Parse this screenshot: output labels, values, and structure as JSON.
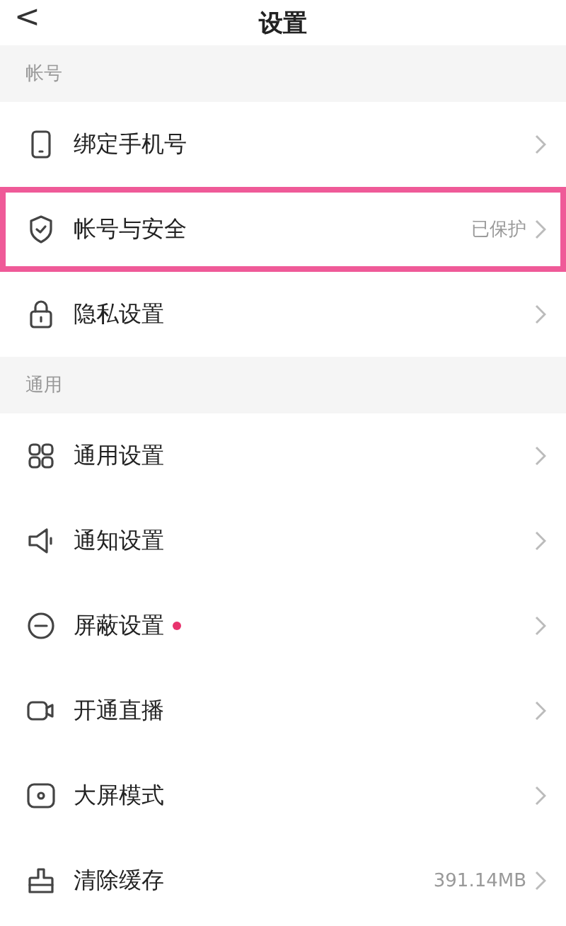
{
  "header": {
    "back": "<",
    "title": "设置"
  },
  "sections": [
    {
      "title": "帐号",
      "items": [
        {
          "label": "绑定手机号",
          "highlighted": false,
          "dot": false
        },
        {
          "label": "帐号与安全",
          "value": "已保护",
          "highlighted": true,
          "dot": false
        },
        {
          "label": "隐私设置",
          "highlighted": false,
          "dot": false
        }
      ]
    },
    {
      "title": "通用",
      "items": [
        {
          "label": "通用设置",
          "highlighted": false,
          "dot": false
        },
        {
          "label": "通知设置",
          "highlighted": false,
          "dot": false
        },
        {
          "label": "屏蔽设置",
          "highlighted": false,
          "dot": true
        },
        {
          "label": "开通直播",
          "highlighted": false,
          "dot": false
        },
        {
          "label": "大屏模式",
          "highlighted": false,
          "dot": false
        },
        {
          "label": "清除缓存",
          "value": "391.14MB",
          "highlighted": false,
          "dot": false
        }
      ]
    }
  ]
}
